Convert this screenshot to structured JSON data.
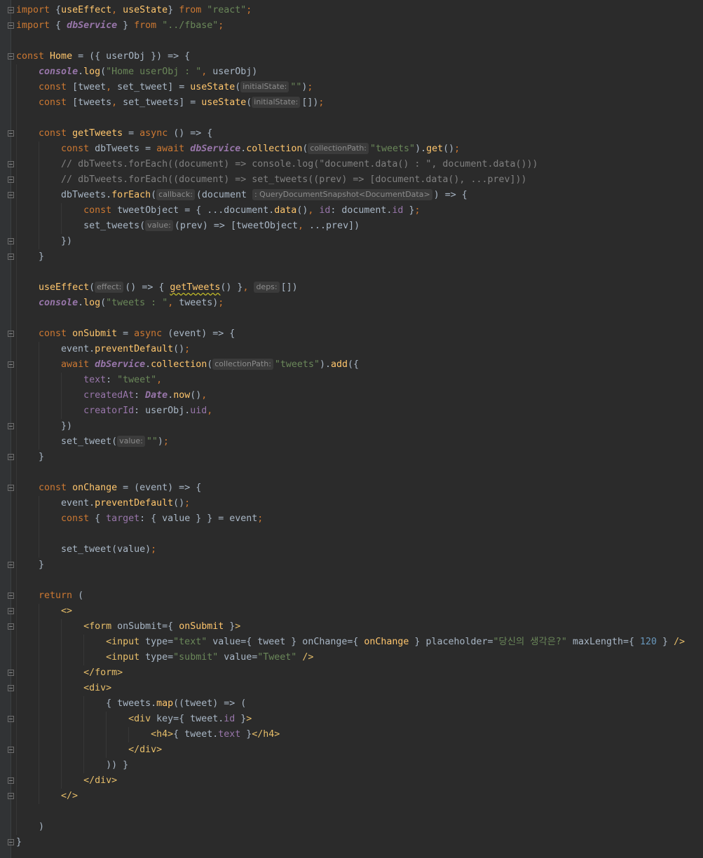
{
  "editor": {
    "language": "jsx",
    "lines": [
      {
        "fold": true,
        "tokens": [
          [
            "kw",
            "import "
          ],
          [
            "pl",
            "{"
          ],
          [
            "fn",
            "useEffect"
          ],
          [
            "pu",
            ", "
          ],
          [
            "fn",
            "useState"
          ],
          [
            "pl",
            "} "
          ],
          [
            "kw",
            "from "
          ],
          [
            "st",
            "\"react\""
          ],
          [
            "pu",
            ";"
          ]
        ]
      },
      {
        "fold": true,
        "tokens": [
          [
            "kw",
            "import "
          ],
          [
            "pl",
            "{ "
          ],
          [
            "gi",
            "dbService"
          ],
          [
            "pl",
            " } "
          ],
          [
            "kw",
            "from "
          ],
          [
            "st",
            "\"../fbase\""
          ],
          [
            "pu",
            ";"
          ]
        ]
      },
      {
        "fold": false,
        "tokens": []
      },
      {
        "fold": true,
        "tokens": [
          [
            "kw",
            "const "
          ],
          [
            "fn",
            "Home"
          ],
          [
            "pl",
            " = ({ userObj }) => {"
          ]
        ]
      },
      {
        "fold": false,
        "tokens": [
          [
            "pl",
            "    "
          ],
          [
            "gi",
            "console"
          ],
          [
            "pl",
            "."
          ],
          [
            "fn",
            "log"
          ],
          [
            "pl",
            "("
          ],
          [
            "st",
            "\"Home userObj : \""
          ],
          [
            "pu",
            ", "
          ],
          [
            "pl",
            "userObj)"
          ]
        ]
      },
      {
        "fold": false,
        "tokens": [
          [
            "pl",
            "    "
          ],
          [
            "kw",
            "const "
          ],
          [
            "pl",
            "[tweet"
          ],
          [
            "pu",
            ", "
          ],
          [
            "pl",
            "set_tweet] = "
          ],
          [
            "fn",
            "useState"
          ],
          [
            "pl",
            "("
          ],
          [
            "hint",
            "initialState:"
          ],
          [
            "st",
            "\"\""
          ],
          [
            "pl",
            ")"
          ],
          [
            "pu",
            ";"
          ]
        ]
      },
      {
        "fold": false,
        "tokens": [
          [
            "pl",
            "    "
          ],
          [
            "kw",
            "const "
          ],
          [
            "pl",
            "[tweets"
          ],
          [
            "pu",
            ", "
          ],
          [
            "pl",
            "set_tweets] = "
          ],
          [
            "fn",
            "useState"
          ],
          [
            "pl",
            "("
          ],
          [
            "hint",
            "initialState:"
          ],
          [
            "pl",
            "[])"
          ],
          [
            "pu",
            ";"
          ]
        ]
      },
      {
        "fold": false,
        "tokens": []
      },
      {
        "fold": true,
        "tokens": [
          [
            "pl",
            "    "
          ],
          [
            "kw",
            "const "
          ],
          [
            "fn",
            "getTweets"
          ],
          [
            "pl",
            " = "
          ],
          [
            "kw",
            "async "
          ],
          [
            "pl",
            "() => {"
          ]
        ]
      },
      {
        "fold": false,
        "tokens": [
          [
            "pl",
            "        "
          ],
          [
            "kw",
            "const "
          ],
          [
            "pl",
            "dbTweets = "
          ],
          [
            "kw",
            "await "
          ],
          [
            "gi",
            "dbService"
          ],
          [
            "pl",
            "."
          ],
          [
            "fn",
            "collection"
          ],
          [
            "pl",
            "("
          ],
          [
            "hint",
            "collectionPath:"
          ],
          [
            "st",
            "\"tweets\""
          ],
          [
            "pl",
            ")."
          ],
          [
            "fn",
            "get"
          ],
          [
            "pl",
            "()"
          ],
          [
            "pu",
            ";"
          ]
        ]
      },
      {
        "fold": true,
        "tokens": [
          [
            "pl",
            "        "
          ],
          [
            "cm",
            "// dbTweets.forEach((document) => console.log(\"document.data() : \", document.data()))"
          ]
        ]
      },
      {
        "fold": true,
        "tokens": [
          [
            "pl",
            "        "
          ],
          [
            "cm",
            "// dbTweets.forEach((document) => set_tweets((prev) => [document.data(), ...prev]))"
          ]
        ]
      },
      {
        "fold": true,
        "tokens": [
          [
            "pl",
            "        dbTweets."
          ],
          [
            "fn",
            "forEach"
          ],
          [
            "pl",
            "("
          ],
          [
            "hint",
            "callback:"
          ],
          [
            "pl",
            "(document "
          ],
          [
            "hint",
            ": QueryDocumentSnapshot<DocumentData>"
          ],
          [
            "pl",
            ") => {"
          ]
        ]
      },
      {
        "fold": false,
        "tokens": [
          [
            "pl",
            "            "
          ],
          [
            "kw",
            "const "
          ],
          [
            "pl",
            "tweetObject = { ...document."
          ],
          [
            "fn",
            "data"
          ],
          [
            "pl",
            "()"
          ],
          [
            "pu",
            ", "
          ],
          [
            "pr",
            "id"
          ],
          [
            "pl",
            ": document."
          ],
          [
            "pr",
            "id"
          ],
          [
            "pl",
            " }"
          ],
          [
            "pu",
            ";"
          ]
        ]
      },
      {
        "fold": false,
        "tokens": [
          [
            "pl",
            "            set_tweets("
          ],
          [
            "hint",
            "value:"
          ],
          [
            "pl",
            "(prev) => [tweetObject"
          ],
          [
            "pu",
            ", "
          ],
          [
            "pl",
            "...prev])"
          ]
        ]
      },
      {
        "fold": true,
        "tokens": [
          [
            "pl",
            "        })"
          ]
        ]
      },
      {
        "fold": true,
        "tokens": [
          [
            "pl",
            "    }"
          ]
        ]
      },
      {
        "fold": false,
        "tokens": []
      },
      {
        "fold": false,
        "tokens": [
          [
            "pl",
            "    "
          ],
          [
            "fn",
            "useEffect"
          ],
          [
            "pl",
            "("
          ],
          [
            "hint",
            "effect:"
          ],
          [
            "pl",
            "() => { "
          ],
          [
            "fnsq",
            "getTweets"
          ],
          [
            "pl",
            "() }"
          ],
          [
            "pu",
            ", "
          ],
          [
            "hint",
            "deps:"
          ],
          [
            "pl",
            "[])"
          ]
        ]
      },
      {
        "fold": false,
        "tokens": [
          [
            "pl",
            "    "
          ],
          [
            "gi",
            "console"
          ],
          [
            "pl",
            "."
          ],
          [
            "fn",
            "log"
          ],
          [
            "pl",
            "("
          ],
          [
            "st",
            "\"tweets : \""
          ],
          [
            "pu",
            ", "
          ],
          [
            "pl",
            "tweets)"
          ],
          [
            "pu",
            ";"
          ]
        ]
      },
      {
        "fold": false,
        "tokens": []
      },
      {
        "fold": true,
        "tokens": [
          [
            "pl",
            "    "
          ],
          [
            "kw",
            "const "
          ],
          [
            "fn",
            "onSubmit"
          ],
          [
            "pl",
            " = "
          ],
          [
            "kw",
            "async "
          ],
          [
            "pl",
            "(event) => {"
          ]
        ]
      },
      {
        "fold": false,
        "tokens": [
          [
            "pl",
            "        event."
          ],
          [
            "fn",
            "preventDefault"
          ],
          [
            "pl",
            "()"
          ],
          [
            "pu",
            ";"
          ]
        ]
      },
      {
        "fold": true,
        "tokens": [
          [
            "pl",
            "        "
          ],
          [
            "kw",
            "await "
          ],
          [
            "gi",
            "dbService"
          ],
          [
            "pl",
            "."
          ],
          [
            "fn",
            "collection"
          ],
          [
            "pl",
            "("
          ],
          [
            "hint",
            "collectionPath:"
          ],
          [
            "st",
            "\"tweets\""
          ],
          [
            "pl",
            ")."
          ],
          [
            "fn",
            "add"
          ],
          [
            "pl",
            "({"
          ]
        ]
      },
      {
        "fold": false,
        "tokens": [
          [
            "pl",
            "            "
          ],
          [
            "pr",
            "text"
          ],
          [
            "pl",
            ": "
          ],
          [
            "st",
            "\"tweet\""
          ],
          [
            "pu",
            ","
          ]
        ]
      },
      {
        "fold": false,
        "tokens": [
          [
            "pl",
            "            "
          ],
          [
            "pr",
            "createdAt"
          ],
          [
            "pl",
            ": "
          ],
          [
            "gi",
            "Date"
          ],
          [
            "pl",
            "."
          ],
          [
            "fn",
            "now"
          ],
          [
            "pl",
            "()"
          ],
          [
            "pu",
            ","
          ]
        ]
      },
      {
        "fold": false,
        "tokens": [
          [
            "pl",
            "            "
          ],
          [
            "pr",
            "creatorId"
          ],
          [
            "pl",
            ": userObj."
          ],
          [
            "pr",
            "uid"
          ],
          [
            "pu",
            ","
          ]
        ]
      },
      {
        "fold": true,
        "tokens": [
          [
            "pl",
            "        })"
          ]
        ]
      },
      {
        "fold": false,
        "tokens": [
          [
            "pl",
            "        set_tweet("
          ],
          [
            "hint",
            "value:"
          ],
          [
            "st",
            "\"\""
          ],
          [
            "pl",
            ")"
          ],
          [
            "pu",
            ";"
          ]
        ]
      },
      {
        "fold": true,
        "tokens": [
          [
            "pl",
            "    }"
          ]
        ]
      },
      {
        "fold": false,
        "tokens": []
      },
      {
        "fold": true,
        "tokens": [
          [
            "pl",
            "    "
          ],
          [
            "kw",
            "const "
          ],
          [
            "fn",
            "onChange"
          ],
          [
            "pl",
            " = (event) => {"
          ]
        ]
      },
      {
        "fold": false,
        "tokens": [
          [
            "pl",
            "        event."
          ],
          [
            "fn",
            "preventDefault"
          ],
          [
            "pl",
            "()"
          ],
          [
            "pu",
            ";"
          ]
        ]
      },
      {
        "fold": false,
        "tokens": [
          [
            "pl",
            "        "
          ],
          [
            "kw",
            "const "
          ],
          [
            "pl",
            "{ "
          ],
          [
            "pr",
            "target"
          ],
          [
            "pl",
            ": { value } } = event"
          ],
          [
            "pu",
            ";"
          ]
        ]
      },
      {
        "fold": false,
        "tokens": []
      },
      {
        "fold": false,
        "tokens": [
          [
            "pl",
            "        set_tweet(value)"
          ],
          [
            "pu",
            ";"
          ]
        ]
      },
      {
        "fold": true,
        "tokens": [
          [
            "pl",
            "    }"
          ]
        ]
      },
      {
        "fold": false,
        "tokens": []
      },
      {
        "fold": true,
        "tokens": [
          [
            "pl",
            "    "
          ],
          [
            "kw",
            "return "
          ],
          [
            "pl",
            "("
          ]
        ]
      },
      {
        "fold": true,
        "tokens": [
          [
            "pl",
            "        "
          ],
          [
            "tg",
            "<>"
          ]
        ]
      },
      {
        "fold": true,
        "tokens": [
          [
            "pl",
            "            "
          ],
          [
            "tg",
            "<form "
          ],
          [
            "pl",
            "onSubmit={ "
          ],
          [
            "fn",
            "onSubmit"
          ],
          [
            "pl",
            " }"
          ],
          [
            "tg",
            ">"
          ]
        ]
      },
      {
        "fold": false,
        "tokens": [
          [
            "pl",
            "                "
          ],
          [
            "tg",
            "<input "
          ],
          [
            "pl",
            "type="
          ],
          [
            "st",
            "\"text\""
          ],
          [
            "pl",
            " value={ tweet } onChange={ "
          ],
          [
            "fn",
            "onChange"
          ],
          [
            "pl",
            " } placeholder="
          ],
          [
            "st",
            "\"당신의 생각은?\""
          ],
          [
            "pl",
            " maxLength={ "
          ],
          [
            "nu",
            "120"
          ],
          [
            "pl",
            " } "
          ],
          [
            "tg",
            "/>"
          ]
        ]
      },
      {
        "fold": false,
        "tokens": [
          [
            "pl",
            "                "
          ],
          [
            "tg",
            "<input "
          ],
          [
            "pl",
            "type="
          ],
          [
            "st",
            "\"submit\""
          ],
          [
            "pl",
            " value="
          ],
          [
            "st",
            "\"Tweet\""
          ],
          [
            "pl",
            " "
          ],
          [
            "tg",
            "/>"
          ]
        ]
      },
      {
        "fold": true,
        "tokens": [
          [
            "pl",
            "            "
          ],
          [
            "tg",
            "</form>"
          ]
        ]
      },
      {
        "fold": true,
        "tokens": [
          [
            "pl",
            "            "
          ],
          [
            "tg",
            "<div>"
          ]
        ]
      },
      {
        "fold": false,
        "tokens": [
          [
            "pl",
            "                { tweets."
          ],
          [
            "fn",
            "map"
          ],
          [
            "pl",
            "((tweet) => ("
          ]
        ]
      },
      {
        "fold": true,
        "tokens": [
          [
            "pl",
            "                    "
          ],
          [
            "tg",
            "<div "
          ],
          [
            "pl",
            "key={ tweet."
          ],
          [
            "pr",
            "id"
          ],
          [
            "pl",
            " }"
          ],
          [
            "tg",
            ">"
          ]
        ]
      },
      {
        "fold": false,
        "tokens": [
          [
            "pl",
            "                        "
          ],
          [
            "tg",
            "<h4>"
          ],
          [
            "pl",
            "{ tweet."
          ],
          [
            "pr",
            "text"
          ],
          [
            "pl",
            " }"
          ],
          [
            "tg",
            "</h4>"
          ]
        ]
      },
      {
        "fold": true,
        "tokens": [
          [
            "pl",
            "                    "
          ],
          [
            "tg",
            "</div>"
          ]
        ]
      },
      {
        "fold": false,
        "tokens": [
          [
            "pl",
            "                )) }"
          ]
        ]
      },
      {
        "fold": true,
        "tokens": [
          [
            "pl",
            "            "
          ],
          [
            "tg",
            "</div>"
          ]
        ]
      },
      {
        "fold": true,
        "tokens": [
          [
            "pl",
            "        "
          ],
          [
            "tg",
            "</>"
          ]
        ]
      },
      {
        "fold": false,
        "tokens": []
      },
      {
        "fold": false,
        "tokens": [
          [
            "pl",
            "    )"
          ]
        ]
      },
      {
        "fold": true,
        "tokens": [
          [
            "pl",
            "}"
          ]
        ]
      }
    ]
  }
}
